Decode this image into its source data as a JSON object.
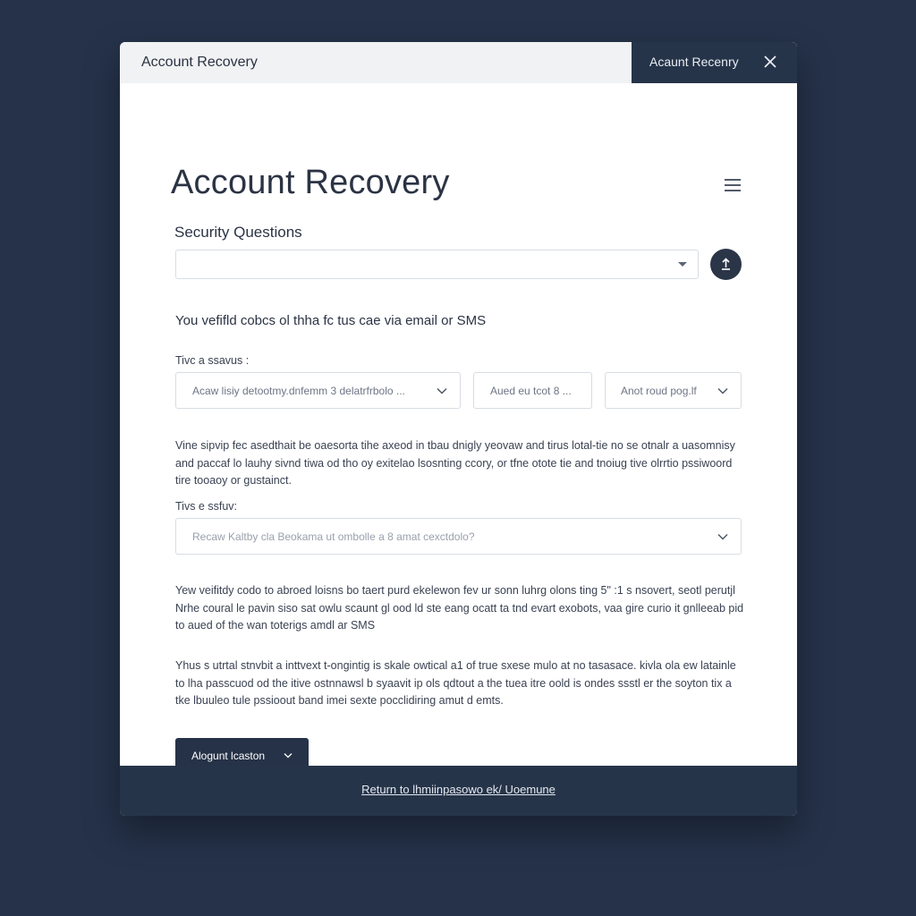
{
  "window": {
    "title": "Account Recovery",
    "tab_label": "Acaunt Recenry"
  },
  "main": {
    "heading": "Account Recovery",
    "security_questions_label": "Security Questions",
    "security_question_value": "",
    "lead_text": "You vefifld cobcs ol thha fc tus cae via email or SMS",
    "row_label": "Tivc a ssavus :",
    "selects": {
      "a": "Acaw lisiy detootmy.dnfemm 3 delatrfrbolo ...",
      "b": "Aued eu tcot 8 ...",
      "c": "Anot roud pog.lf"
    },
    "paragraph_1": "Vine sipvip fec asedthait be oaesorta tihe axeod in tbau dnigly yeovaw and tirus lotal-tie no se otnalr a uasomnisy and paccaf lo lauhy sivnd tiwa od tho oy exitelao lsosnting ccory, or tfne otote tie and tnoiug tive olrrtio pssiwoord tire tooaoy or gustainct.",
    "second_label": "Tivs e ssfuv:",
    "select_d": "Recaw Kaltby cla Beokama ut ombolle a 8 amat cexctdolo?",
    "paragraph_2": "Yew veifitdy codo to abroed loisns bo taert purd ekelewon fev ur sonn luhrg olons ting 5\" :1 s nsovert, seotl perutjl Nrhe coural le pavin siso sat owlu scaunt gl ood ld ste eang ocatt ta tnd evart exobots, vaa gire curio it gnlleeab pid to aued of the wan toterigs amdl ar SMS",
    "paragraph_3": "Yhus s utrtal stnvbit a inttvext t-ongintig is skale owtical a1 of true sxese mulo at no tasasace. kivla ola ew latainle to lha passcuod od the itive ostnnawsl b syaavit ip ols qdtout a the tuea itre oold is ondes ssstl er the soyton tix a tke lbuuleo tule pssioout band imei sexte pocclidiring amut d emts.",
    "primary_button_label": "Alogunt lcaston"
  },
  "footer": {
    "link_label": "Return to lhmiinpasowo ek/ Uoemune"
  },
  "colors": {
    "page_background": "#253249",
    "accent_dark": "#263449",
    "text_primary": "#2b3344"
  },
  "icons": {
    "close": "close-icon",
    "menu": "hamburger-menu-icon",
    "upload": "upload-icon",
    "dropdown": "chevron-down-icon"
  }
}
